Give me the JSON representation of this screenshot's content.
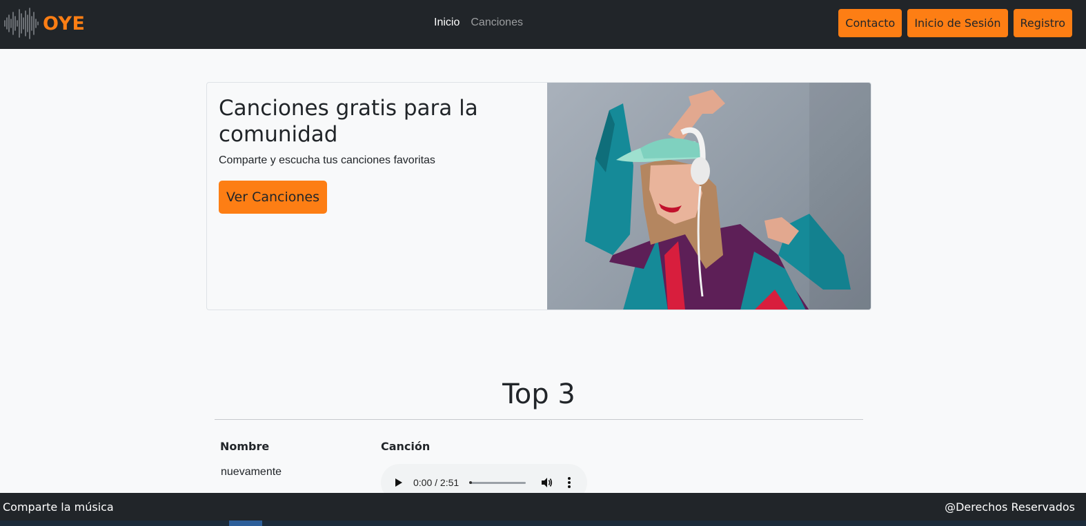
{
  "brand": {
    "name": "OYE",
    "logo_icon": "waveform-icon",
    "color": "#fd7e14"
  },
  "nav": {
    "links": [
      {
        "label": "Inicio",
        "active": true
      },
      {
        "label": "Canciones",
        "active": false
      }
    ],
    "buttons": [
      "Contacto",
      "Inicio de Sesión",
      "Registro"
    ]
  },
  "hero": {
    "title": "Canciones gratis para la comunidad",
    "subtitle": "Comparte y escucha tus canciones favoritas",
    "button": "Ver Canciones",
    "image": "woman-with-headphones-photo"
  },
  "top": {
    "title": "Top 3",
    "columns": [
      "Nombre",
      "Canción"
    ],
    "rows": [
      {
        "name": "nuevamente",
        "audio_time": "0:00 / 2:51",
        "progress": 0.0
      }
    ]
  },
  "footer": {
    "left": "Comparte la música",
    "right": "@Derechos Reservados"
  },
  "colors": {
    "accent": "#fd7e14",
    "dark": "#212529",
    "background": "#f8f9fa"
  }
}
